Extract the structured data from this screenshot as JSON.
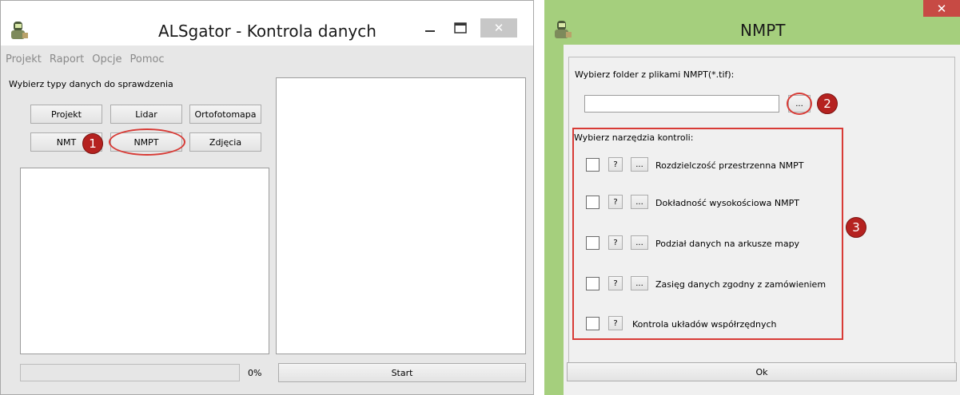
{
  "colors": {
    "accent_red": "#d83b36",
    "marker": "#b52220",
    "window_green": "#a5cf7d",
    "close_red": "#c74a44"
  },
  "main_window": {
    "title": "ALSgator - Kontrola danych",
    "icon": "alsgator-app-icon",
    "menu": [
      "Projekt",
      "Raport",
      "Opcje",
      "Pomoc"
    ],
    "choose_label": "Wybierz typy danych do sprawdzenia",
    "buttons": {
      "projekt": "Projekt",
      "lidar": "Lidar",
      "ortofotomapa": "Ortofotomapa",
      "nmt": "NMT",
      "nmpt": "NMPT",
      "zdjecia": "Zdjęcia"
    },
    "progress_percent_label": "0%",
    "progress_value": 0,
    "start_label": "Start"
  },
  "dialog": {
    "title": "NMPT",
    "icon": "alsgator-app-icon",
    "folder_label": "Wybierz folder z plikami NMPT(*.tif):",
    "folder_value": "",
    "browse_label": "...",
    "tools_label": "Wybierz narzędzia kontroli:",
    "help_label": "?",
    "config_label": "...",
    "tools": [
      {
        "label": "Rozdzielczość przestrzenna NMPT"
      },
      {
        "label": "Dokładność wysokościowa NMPT"
      },
      {
        "label": "Podział danych na arkusze mapy"
      },
      {
        "label": "Zasięg danych zgodny z zamówieniem"
      },
      {
        "label": "Kontrola układów współrzędnych"
      }
    ],
    "ok_label": "Ok"
  },
  "markers": {
    "m1": "1",
    "m2": "2",
    "m3": "3"
  }
}
